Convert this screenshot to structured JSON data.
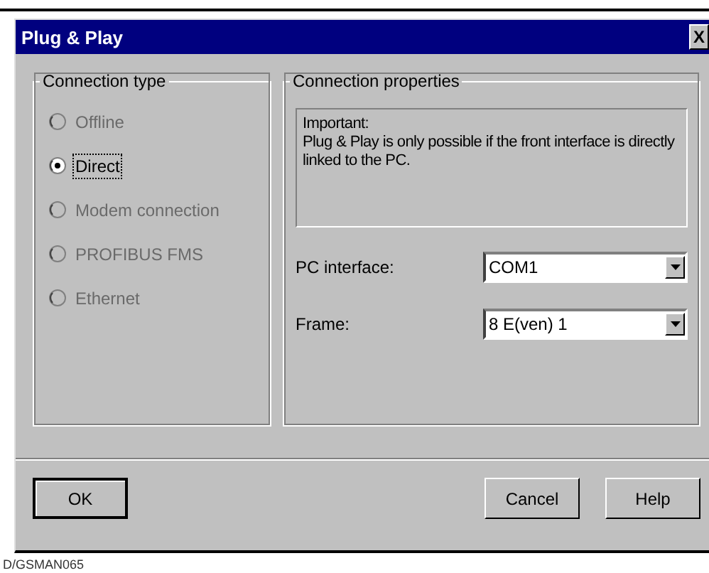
{
  "window": {
    "title": "Plug & Play",
    "close": "X"
  },
  "connection_type": {
    "title": "Connection type",
    "options": [
      {
        "label": "Offline",
        "selected": false,
        "disabled": true
      },
      {
        "label": "Direct",
        "selected": true,
        "disabled": false
      },
      {
        "label": "Modem connection",
        "selected": false,
        "disabled": true
      },
      {
        "label": "PROFIBUS FMS",
        "selected": false,
        "disabled": true
      },
      {
        "label": "Ethernet",
        "selected": false,
        "disabled": true
      }
    ]
  },
  "connection_properties": {
    "title": "Connection properties",
    "note": "Important:\nPlug & Play is only possible if the front interface is directly linked to the PC.",
    "fields": [
      {
        "label": "PC interface:",
        "value": "COM1"
      },
      {
        "label": "Frame:",
        "value": "8 E(ven) 1"
      }
    ]
  },
  "buttons": [
    {
      "label": "OK",
      "kind": "default"
    },
    {
      "label": "Cancel",
      "kind": "normal"
    },
    {
      "label": "Help",
      "kind": "normal"
    }
  ],
  "caption": "D/GSMAN065"
}
